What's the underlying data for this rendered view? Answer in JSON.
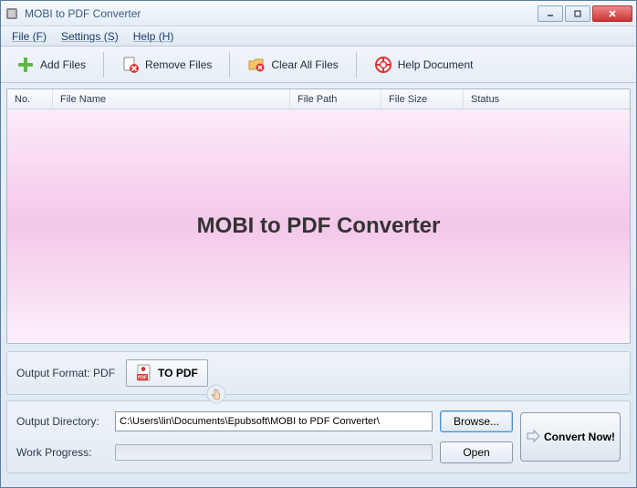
{
  "window": {
    "title": "MOBI to PDF Converter"
  },
  "menu": {
    "file": "File (F)",
    "settings": "Settings (S)",
    "help": "Help (H)"
  },
  "toolbar": {
    "add": "Add Files",
    "remove": "Remove Files",
    "clear": "Clear All Files",
    "helpdoc": "Help Document"
  },
  "columns": {
    "no": "No.",
    "name": "File Name",
    "path": "File Path",
    "size": "File Size",
    "status": "Status"
  },
  "watermark": "MOBI to PDF Converter",
  "output": {
    "format_label": "Output Format: PDF",
    "to_pdf": "TO PDF",
    "dir_label": "Output Directory:",
    "dir_value": "C:\\Users\\lin\\Documents\\Epubsoft\\MOBI to PDF Converter\\",
    "browse": "Browse...",
    "progress_label": "Work Progress:",
    "open": "Open",
    "convert": "Convert Now!"
  }
}
